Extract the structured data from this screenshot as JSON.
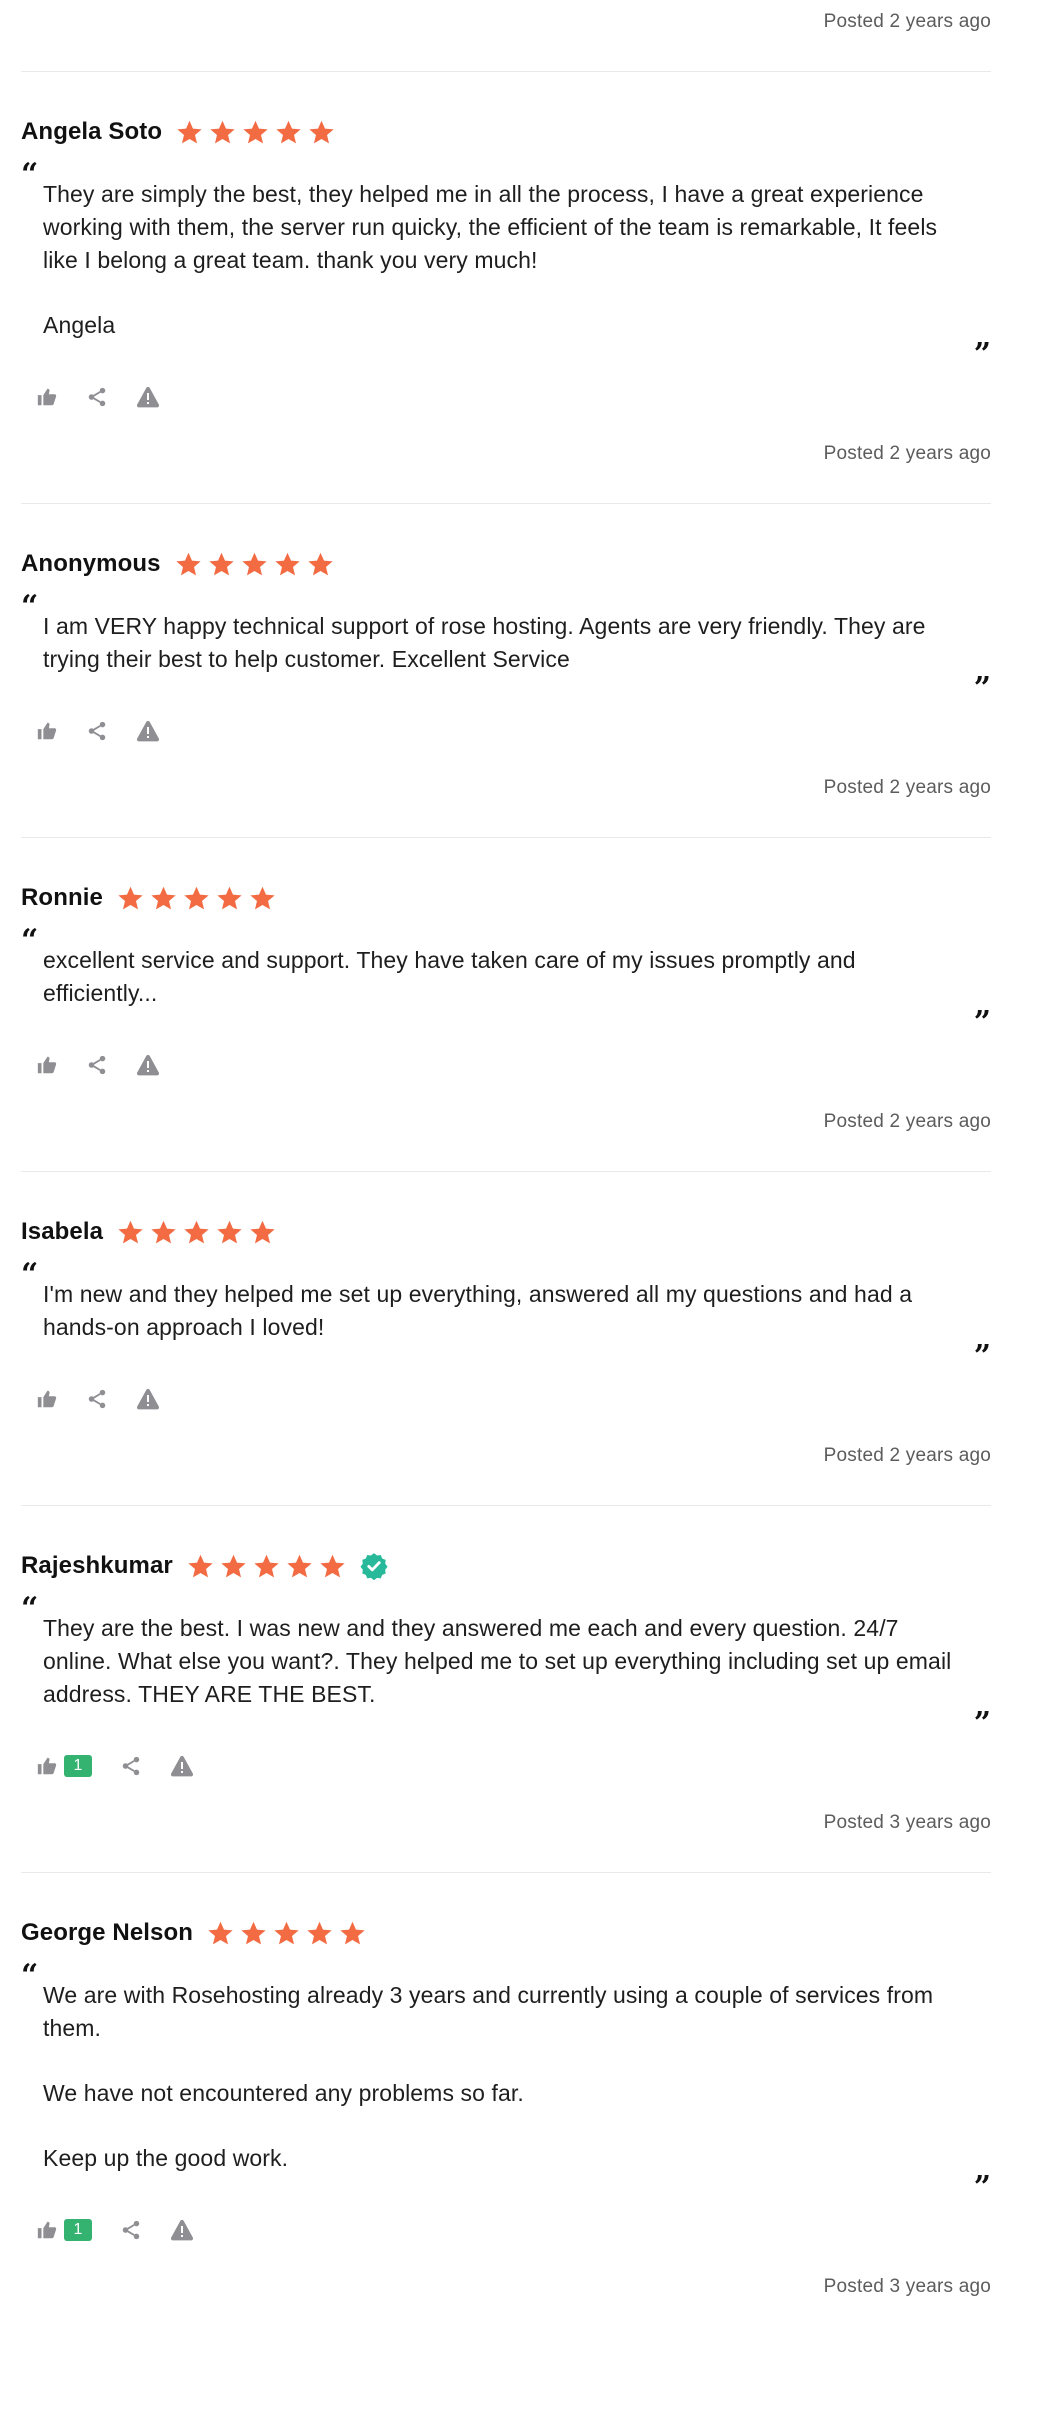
{
  "colors": {
    "star": "#f26b43",
    "verified": "#27b99a",
    "badge": "#34b26f",
    "icon": "#8e8e93"
  },
  "top_posted": "Posted 2 years ago",
  "reviews": [
    {
      "name": "Angela Soto",
      "rating": 5,
      "verified": false,
      "paragraphs": [
        "They are simply the best, they helped me in all the process, I have a great experience working with them, the server run quicky, the efficient of the team is remarkable, It feels like I belong a great team. thank you very much!",
        "Angela"
      ],
      "likes": "",
      "posted": "Posted 2 years ago"
    },
    {
      "name": "Anonymous",
      "rating": 5,
      "verified": false,
      "paragraphs": [
        "I am VERY happy technical support of rose hosting. Agents are very friendly. They are trying their best to help customer. Excellent Service"
      ],
      "likes": "",
      "posted": "Posted 2 years ago"
    },
    {
      "name": "Ronnie",
      "rating": 5,
      "verified": false,
      "paragraphs": [
        "excellent service and support. They have taken care of my issues promptly and efficiently..."
      ],
      "likes": "",
      "posted": "Posted 2 years ago"
    },
    {
      "name": "Isabela",
      "rating": 5,
      "verified": false,
      "paragraphs": [
        "I'm new and they helped me set up everything, answered all my questions and had a hands-on approach I loved!"
      ],
      "likes": "",
      "posted": "Posted 2 years ago"
    },
    {
      "name": "Rajeshkumar",
      "rating": 5,
      "verified": true,
      "paragraphs": [
        "They are the best. I was new and they answered me each and every question. 24/7 online. What else you want?. They helped me to set up everything including set up email address. THEY ARE THE BEST."
      ],
      "likes": "1",
      "posted": "Posted 3 years ago"
    },
    {
      "name": "George Nelson",
      "rating": 5,
      "verified": false,
      "paragraphs": [
        "We are with Rosehosting already 3 years and currently using a couple of services from them.",
        "We have not encountered any problems so far.",
        "Keep up the good work."
      ],
      "likes": "1",
      "posted": "Posted 3 years ago"
    }
  ],
  "icons": {
    "like": "thumbs-up-icon",
    "share": "share-icon",
    "report": "warning-icon",
    "quote_open": "“",
    "quote_close": "”"
  }
}
